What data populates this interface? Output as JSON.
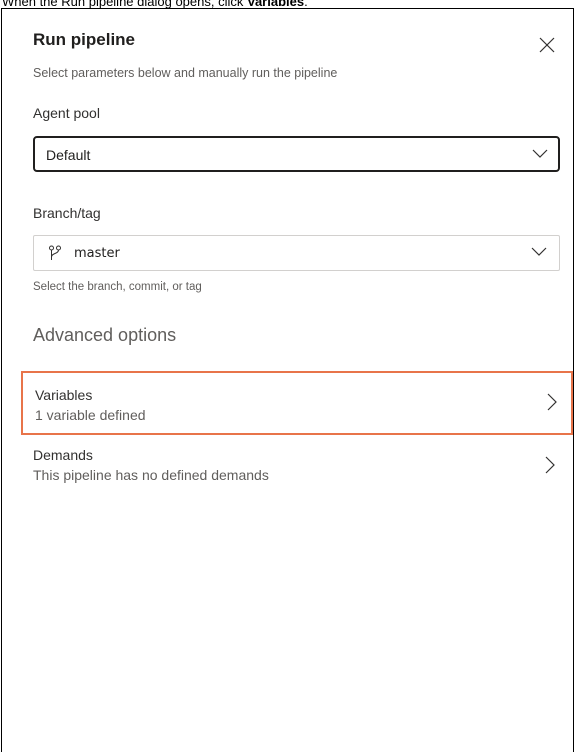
{
  "instruction": {
    "prefix": "When the Run pipeline dialog opens, click ",
    "bold": "Variables",
    "suffix": "."
  },
  "dialog": {
    "title": "Run pipeline",
    "subtitle": "Select parameters below and manually run the pipeline",
    "agent_pool": {
      "label": "Agent pool",
      "value": "Default"
    },
    "branch": {
      "label": "Branch/tag",
      "value": "master",
      "helper": "Select the branch, commit, or tag"
    },
    "advanced": {
      "title": "Advanced options",
      "variables": {
        "title": "Variables",
        "description": "1 variable defined"
      },
      "demands": {
        "title": "Demands",
        "description": "This pipeline has no defined demands"
      }
    }
  },
  "colors": {
    "highlight": "#e8744a",
    "text": "#323130",
    "muted": "#605e5c"
  }
}
